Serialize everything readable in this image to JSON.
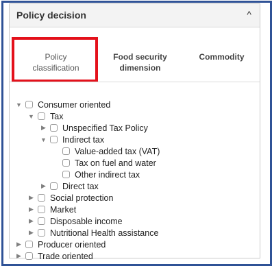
{
  "panel": {
    "title": "Policy decision",
    "collapse_icon": "^"
  },
  "tabs": [
    {
      "line1": "Policy",
      "line2": "classification"
    },
    {
      "line1": "Food security",
      "line2": "dimension"
    },
    {
      "line1": "Commodity",
      "line2": ""
    }
  ],
  "tree": [
    {
      "label": "Consumer oriented",
      "expand": "▼"
    },
    {
      "label": "Tax",
      "expand": "▼"
    },
    {
      "label": "Unspecified Tax Policy",
      "expand": "▶"
    },
    {
      "label": "Indirect tax",
      "expand": "▼"
    },
    {
      "label": "Value-added tax (VAT)",
      "expand": ""
    },
    {
      "label": "Tax on fuel and water",
      "expand": ""
    },
    {
      "label": "Other indirect tax",
      "expand": ""
    },
    {
      "label": "Direct tax",
      "expand": "▶"
    },
    {
      "label": "Social protection",
      "expand": "▶"
    },
    {
      "label": "Market",
      "expand": "▶"
    },
    {
      "label": "Disposable income",
      "expand": "▶"
    },
    {
      "label": "Nutritional Health assistance",
      "expand": "▶"
    },
    {
      "label": "Producer oriented",
      "expand": "▶"
    },
    {
      "label": "Trade oriented",
      "expand": "▶"
    }
  ]
}
